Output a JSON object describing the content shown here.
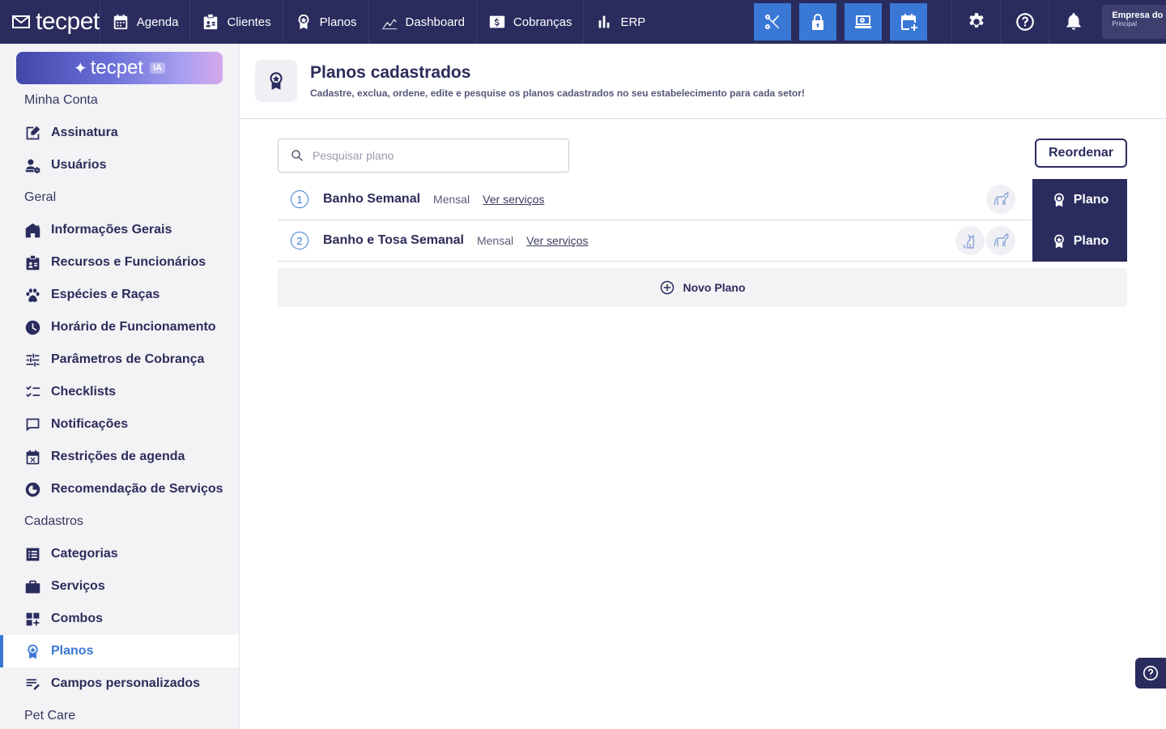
{
  "topbar": {
    "logo": "tecpet",
    "nav": [
      {
        "label": "Agenda",
        "icon": "calendar-icon"
      },
      {
        "label": "Clientes",
        "icon": "id-badge-icon"
      },
      {
        "label": "Planos",
        "icon": "award-icon"
      },
      {
        "label": "Dashboard",
        "icon": "chart-line-icon"
      },
      {
        "label": "Cobranças",
        "icon": "dollar-icon"
      },
      {
        "label": "ERP",
        "icon": "bar-chart-icon"
      }
    ],
    "quick_actions": [
      "scissors-icon",
      "lock-icon",
      "cashier-icon",
      "calendar-add-icon"
    ],
    "right_icons": [
      "gear-icon",
      "help-icon",
      "bell-icon"
    ],
    "company_name": "Empresa do Gomes",
    "company_sub": "Principal",
    "accent": "#3a78d6",
    "navy": "#2a2c5e"
  },
  "sidebar": {
    "ia_banner": "tecpet",
    "ia_badge": "IA",
    "sections": {
      "minha_conta": "Minha Conta",
      "geral": "Geral",
      "cadastros": "Cadastros",
      "pet_care": "Pet Care"
    },
    "items": {
      "assinatura": "Assinatura",
      "usuarios": "Usuários",
      "informacoes": "Informações Gerais",
      "recursos": "Recursos e Funcionários",
      "especies": "Espécies e Raças",
      "horario": "Horário de Funcionamento",
      "parametros": "Parâmetros de Cobrança",
      "checklists": "Checklists",
      "notificacoes": "Notificações",
      "restricoes": "Restrições de agenda",
      "recomendacao": "Recomendação de Serviços",
      "categorias": "Categorias",
      "servicos": "Serviços",
      "combos": "Combos",
      "planos": "Planos",
      "campos": "Campos personalizados"
    }
  },
  "header": {
    "title": "Planos cadastrados",
    "subtitle": "Cadastre, exclua, ordene, edite e pesquise os planos cadastrados no seu estabelecimento para cada setor!"
  },
  "search": {
    "placeholder": "Pesquisar plano",
    "value": ""
  },
  "reorder_label": "Reordenar",
  "plans": [
    {
      "index": "1",
      "name": "Banho Semanal",
      "period": "Mensal",
      "link": "Ver serviços",
      "pets": [
        "dog-icon"
      ],
      "action": "Plano"
    },
    {
      "index": "2",
      "name": "Banho e Tosa Semanal",
      "period": "Mensal",
      "link": "Ver serviços",
      "pets": [
        "cat-icon",
        "dog-icon"
      ],
      "action": "Plano"
    }
  ],
  "new_plan_label": "Novo Plano"
}
